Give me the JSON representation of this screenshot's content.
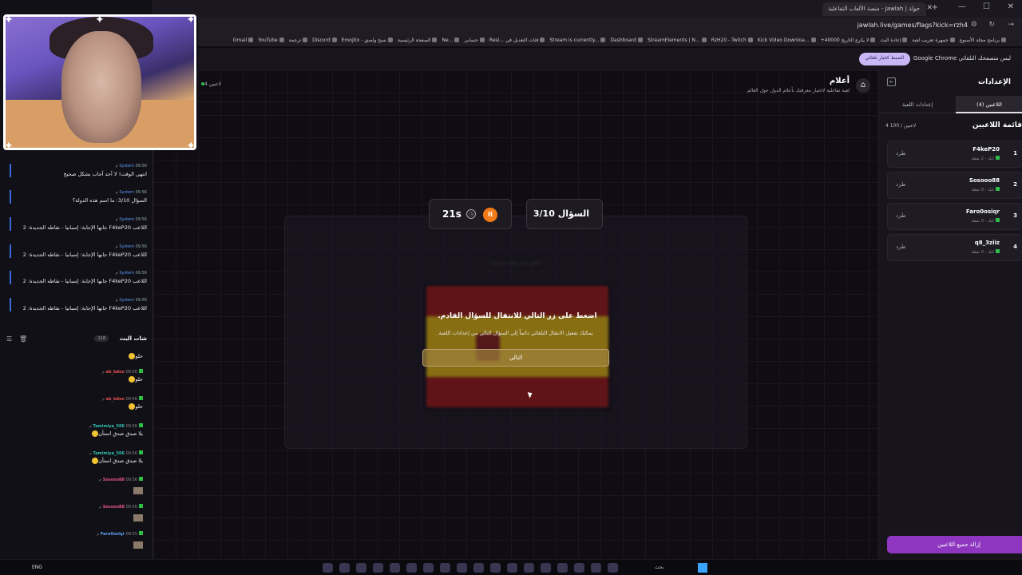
{
  "browser": {
    "tab_title": "جولة | Jawlah - منصة الألعاب التفاعلية",
    "url": "jawlah.live/games/flags?kick=rzh4",
    "bookmarks": [
      "برنامج مجلة الأسبوع",
      "جمهرة تعريب لعبة",
      "إعادة البث",
      "+40000 لا يكرع التاريخ",
      "Kick Video Downloa...",
      "RzH20 - Twitch",
      "StreamElements | N...",
      "Dashboard",
      "Stream is currently...",
      "Resi... فئات التعديل في",
      "حسابي",
      "Ne...",
      "الصفحة الرئيسية",
      "Emojito - نسخ ولصق",
      "Discord",
      "ترجمة",
      "YouTube",
      "Gmail"
    ],
    "infobar_message": "Google Chrome ليس متصفحك التلقائي",
    "infobar_button": "الضبط كخيار تلقائي"
  },
  "chat_log": [
    {
      "user": "System",
      "time": "09:56 م",
      "text": "انتهى الوقت! لا أحد أجاب بشكل صحيح"
    },
    {
      "user": "System",
      "time": "09:56 م",
      "text": "السؤال 3/10: ما اسم هذه الدولة؟"
    },
    {
      "user": "System",
      "time": "09:56 م",
      "text": "اللاعب F4keP20 جابها الإجابة: إسبانيا - نقاطه الجديدة: 2"
    },
    {
      "user": "System",
      "time": "09:56 م",
      "text": "اللاعب F4keP20 جابها الإجابة: إسبانيا - نقاطه الجديدة: 2"
    },
    {
      "user": "System",
      "time": "09:56 م",
      "text": "اللاعب F4keP20 جابها الإجابة: إسبانيا - نقاطه الجديدة: 2"
    },
    {
      "user": "System",
      "time": "09:56 م",
      "text": "اللاعب F4keP20 جابها الإجابة: إسبانيا - نقاطه الجديدة: 2"
    }
  ],
  "live_chat": {
    "title": "شات البث",
    "count": "118",
    "messages": [
      {
        "user": "",
        "time": "",
        "text": "حلو",
        "user_color": "#e05050"
      },
      {
        "user": "ab_bdoo",
        "time": "09:56 م",
        "text": "حلو",
        "user_color": "#e05050"
      },
      {
        "user": "ab_bdoo",
        "time": "09:56 م",
        "text": "حلو",
        "user_color": "#e05050"
      },
      {
        "user": "Tamimiya_506",
        "time": "09:56 م",
        "text": "يلا صدق صدق استأن",
        "user_color": "#30c0b0"
      },
      {
        "user": "Tamimiya_506",
        "time": "09:56 م",
        "text": "يلا صدق صدق استأن",
        "user_color": "#30c0b0"
      },
      {
        "user": "Sosooo88",
        "time": "09:56 م",
        "text": "",
        "user_color": "#e0508a"
      },
      {
        "user": "Sosooo88",
        "time": "09:56 م",
        "text": "",
        "user_color": "#e0508a"
      },
      {
        "user": "Faro0osiqr",
        "time": "09:55 م",
        "text": "",
        "user_color": "#5aa0f0"
      }
    ]
  },
  "game": {
    "title": "أعلام",
    "subtitle": "لعبة تفاعلية لاختبار معرفتك بأعلام الدول حول العالم",
    "players_online": "4 لاعبين",
    "timer": "21s",
    "question_counter": "السؤال 3/10",
    "overlay_title": "اضغط على زر التالي للانتقال للسؤال القادم.",
    "overlay_sub": "يمكنك تفعيل الانتقال التلقائي دائماً إلى السؤال التالي من إعدادات اللعبة.",
    "next_button": "التالي",
    "blurred_text": "ماهي اسم هذه الدولة؟"
  },
  "settings": {
    "title": "الإعدادات",
    "tab_players": "اللاعبين (4)",
    "tab_game_settings": "إعدادات اللعبة",
    "list_title": "قائمة اللاعبين",
    "count": "4 لاعبين / 100",
    "kick_label": "طرد",
    "players": [
      {
        "rank": "1",
        "name": "F4keP20",
        "points": "كيك - 2 نقطة"
      },
      {
        "rank": "2",
        "name": "Sosooo88",
        "points": "كيك - 0 نقطة"
      },
      {
        "rank": "3",
        "name": "Faro0osiqr",
        "points": "كيك - 0 نقطة"
      },
      {
        "rank": "4",
        "name": "q8_3ziiz",
        "points": "كيك - 0 نقطة"
      }
    ],
    "remove_all": "إزالة جميع اللاعبين"
  },
  "taskbar": {
    "lang": "ENG",
    "search": "بحث"
  },
  "colors": {
    "accent_purple": "#8e36c0",
    "timer_orange": "#f07a18",
    "kick_green": "#2fbd4a"
  }
}
